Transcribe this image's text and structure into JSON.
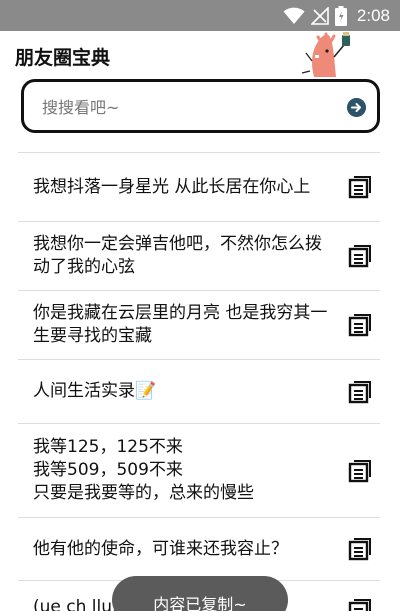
{
  "status_bar": {
    "time": "2:08",
    "icons": [
      "wifi-icon",
      "signal-icon",
      "battery-icon"
    ]
  },
  "header": {
    "title": "朋友圈宝典"
  },
  "search": {
    "placeholder": "搜搜看吧~",
    "icon": "go-arrow-icon"
  },
  "list": {
    "items": [
      {
        "text": "我想抖落一身星光 从此长居在你心上"
      },
      {
        "text": "我想你一定会弹吉他吧，不然你怎么拨动了我的心弦"
      },
      {
        "text": "你是我藏在云层里的月亮 也是我穷其一生要寻找的宝藏"
      },
      {
        "text": "人间生活实录📝"
      },
      {
        "text": "我等125，125不来\n我等509，509不来\n只要是我要等的，总来的慢些"
      },
      {
        "text": "他有他的使命，可谁来还我容止？"
      },
      {
        "text": "(ue ch llu.)"
      }
    ],
    "copy_icon": "copy-document-icon"
  },
  "toast": {
    "text": "内容已复制~"
  }
}
